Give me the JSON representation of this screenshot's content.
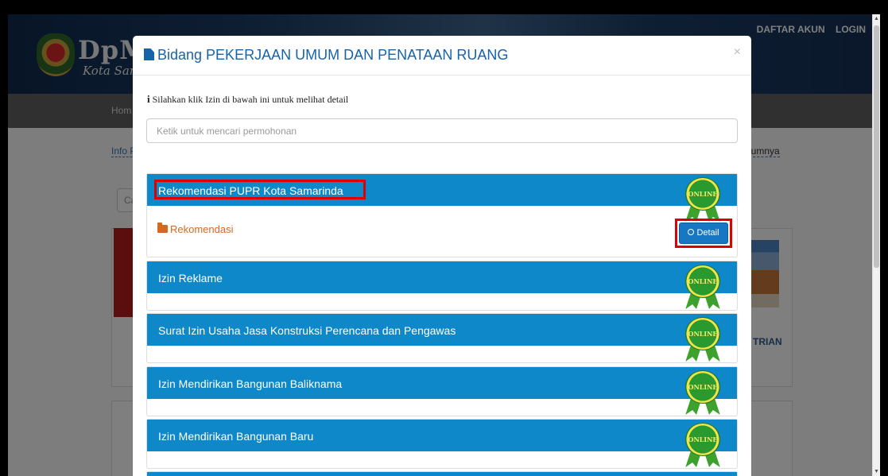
{
  "background": {
    "brand_text": "DpM",
    "brand_sub": "Kota Sam",
    "top_links": [
      "DAFTAR AKUN",
      "LOGIN"
    ],
    "nav_home": "Hom",
    "info_left": "Info P",
    "info_right": "lumnya",
    "search_partial": "Ca",
    "card_right_text": "TRIAN"
  },
  "modal": {
    "title": "Bidang PEKERJAAN UMUM DAN PENATAAN RUANG",
    "close": "×",
    "info_text": "Silahkan klik Izin di bawah ini untuk melihat detail",
    "search_placeholder": "Ketik untuk mencari permohonan",
    "badge_text": "ONLINE",
    "items": [
      {
        "title": "Rekomendasi PUPR Kota Samarinda",
        "category": "Rekomendasi",
        "button": "Detail"
      },
      {
        "title": "Izin Reklame"
      },
      {
        "title": "Surat Izin Usaha Jasa Konstruksi Perencana dan Pengawas"
      },
      {
        "title": "Izin Mendirikan Bangunan Baliknama"
      },
      {
        "title": "Izin Mendirikan Bangunan Baru"
      }
    ]
  },
  "colors": {
    "panel_header": "#0f88c9",
    "title_blue": "#1763a9",
    "highlight_red": "#dd0000",
    "category_orange": "#d2691e"
  }
}
